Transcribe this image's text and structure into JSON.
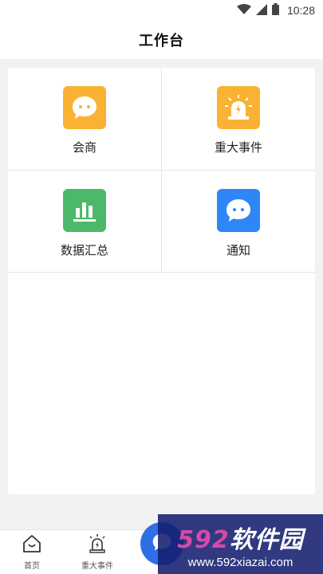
{
  "status_bar": {
    "time": "10:28",
    "icons": [
      "wifi-icon",
      "signal-icon",
      "battery-icon"
    ]
  },
  "header": {
    "title": "工作台"
  },
  "grid": {
    "items": [
      {
        "label": "会商",
        "icon": "chat-icon",
        "color": "#f9b233"
      },
      {
        "label": "重大事件",
        "icon": "alarm-siren-icon",
        "color": "#f9b233"
      },
      {
        "label": "数据汇总",
        "icon": "bar-chart-icon",
        "color": "#4cb96a"
      },
      {
        "label": "通知",
        "icon": "chat-icon",
        "color": "#2f86f6"
      }
    ]
  },
  "tabbar": {
    "tabs": [
      {
        "label": "首页",
        "icon": "home-icon"
      },
      {
        "label": "重大事件",
        "icon": "alarm-siren-icon"
      }
    ],
    "center_icon": "chat-icon",
    "accent": "#2f6fe6"
  },
  "watermark": {
    "brand_num": "592",
    "brand_text": "软件园",
    "url": "www.592xiazai.com"
  }
}
